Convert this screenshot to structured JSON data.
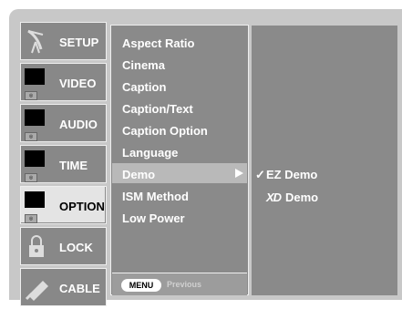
{
  "tabs": [
    {
      "label": "SETUP",
      "icon": "satellite-dish-icon",
      "active": false
    },
    {
      "label": "VIDEO",
      "icon": "tv-icon",
      "active": false
    },
    {
      "label": "AUDIO",
      "icon": "tv-icon",
      "active": false
    },
    {
      "label": "TIME",
      "icon": "tv-icon",
      "active": false
    },
    {
      "label": "OPTION",
      "icon": "tv-icon",
      "active": true
    },
    {
      "label": "LOCK",
      "icon": "lock-icon",
      "active": false
    },
    {
      "label": "CABLE",
      "icon": "cable-icon",
      "active": false
    }
  ],
  "submenu": {
    "items": [
      "Aspect Ratio",
      "Cinema",
      "Caption",
      "Caption/Text",
      "Caption Option",
      "Language",
      "Demo",
      "ISM Method",
      "Low Power"
    ],
    "selected": "Demo",
    "footer": {
      "button": "MENU",
      "label": "Previous"
    }
  },
  "demo_options": [
    {
      "check": "✓",
      "label": "EZ Demo",
      "selected": true
    },
    {
      "logo": "XD",
      "label": "Demo",
      "selected": false
    }
  ],
  "tv_tag": "◎"
}
